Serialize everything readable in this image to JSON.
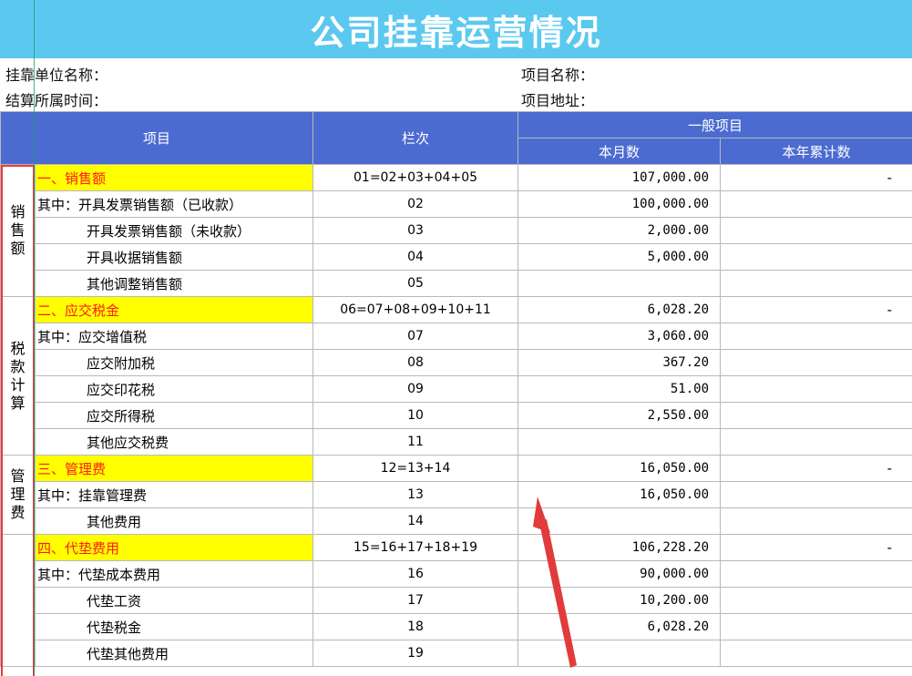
{
  "title": "公司挂靠运营情况",
  "info": {
    "unit_label": "挂靠单位名称：",
    "period_label": "结算所属时间：",
    "project_name_label": "项目名称：",
    "project_addr_label": "项目地址："
  },
  "header": {
    "item": "项目",
    "column": "栏次",
    "group": "一般项目",
    "this_month": "本月数",
    "ytd": "本年累计数"
  },
  "categories": {
    "sales": [
      "销",
      "售",
      "额"
    ],
    "tax": [
      "税",
      "款",
      "计",
      "算"
    ],
    "mgmt": [
      "管",
      "理",
      "费"
    ]
  },
  "rows": [
    {
      "name": "一、销售额",
      "col": "01=02+03+04+05",
      "month": "107,000.00",
      "ytd": "-"
    },
    {
      "name": "其中：开具发票销售额（已收款）",
      "col": "02",
      "month": "100,000.00",
      "ytd": ""
    },
    {
      "name": "开具发票销售额（未收款）",
      "col": "03",
      "month": "2,000.00",
      "ytd": ""
    },
    {
      "name": "开具收据销售额",
      "col": "04",
      "month": "5,000.00",
      "ytd": ""
    },
    {
      "name": "其他调整销售额",
      "col": "05",
      "month": "",
      "ytd": ""
    },
    {
      "name": "二、应交税金",
      "col": "06=07+08+09+10+11",
      "month": "6,028.20",
      "ytd": "-"
    },
    {
      "name": "其中：应交增值税",
      "col": "07",
      "month": "3,060.00",
      "ytd": ""
    },
    {
      "name": "应交附加税",
      "col": "08",
      "month": "367.20",
      "ytd": ""
    },
    {
      "name": "应交印花税",
      "col": "09",
      "month": "51.00",
      "ytd": ""
    },
    {
      "name": "应交所得税",
      "col": "10",
      "month": "2,550.00",
      "ytd": ""
    },
    {
      "name": "其他应交税费",
      "col": "11",
      "month": "",
      "ytd": ""
    },
    {
      "name": "三、管理费",
      "col": "12=13+14",
      "month": "16,050.00",
      "ytd": "-"
    },
    {
      "name": "其中：挂靠管理费",
      "col": "13",
      "month": "16,050.00",
      "ytd": ""
    },
    {
      "name": "其他费用",
      "col": "14",
      "month": "",
      "ytd": ""
    },
    {
      "name": "四、代垫费用",
      "col": "15=16+17+18+19",
      "month": "106,228.20",
      "ytd": "-"
    },
    {
      "name": "其中：代垫成本费用",
      "col": "16",
      "month": "90,000.00",
      "ytd": ""
    },
    {
      "name": "代垫工资",
      "col": "17",
      "month": "10,200.00",
      "ytd": ""
    },
    {
      "name": "代垫税金",
      "col": "18",
      "month": "6,028.20",
      "ytd": ""
    },
    {
      "name": "代垫其他费用",
      "col": "19",
      "month": "",
      "ytd": ""
    }
  ],
  "colors": {
    "title_bg": "#5bc8ef",
    "header_bg": "#4b6bd1",
    "highlight": "#ffff00",
    "highlight_text": "#ff1a1a",
    "annotation": "#e23b3b"
  }
}
